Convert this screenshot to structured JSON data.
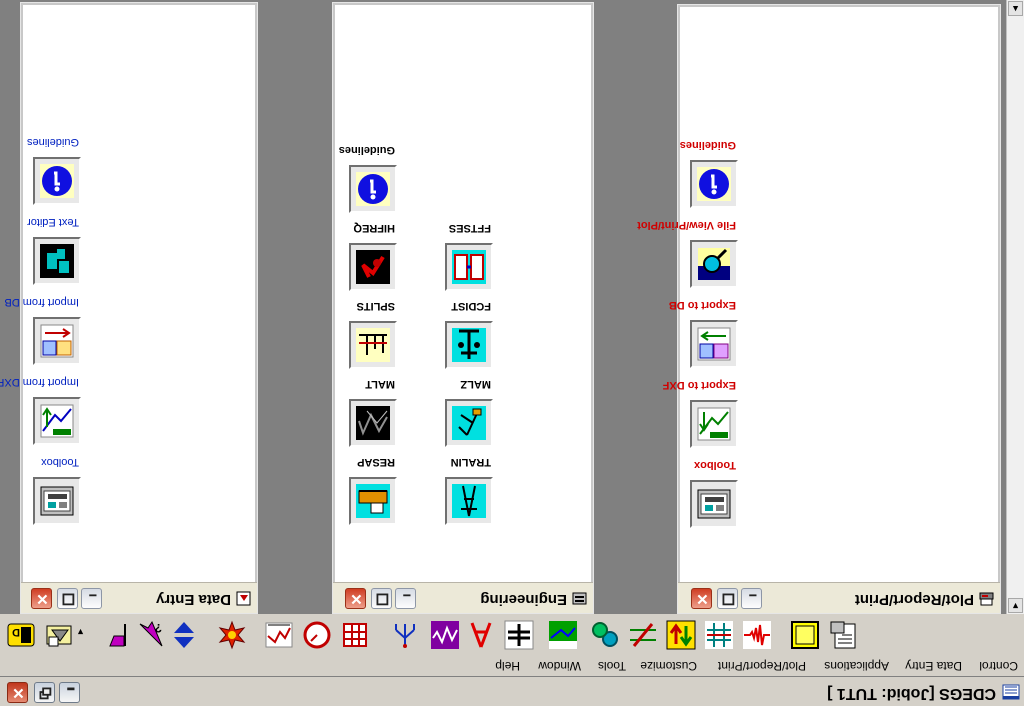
{
  "app": {
    "title": "CDEGS [Jobid: TUT1 ]"
  },
  "menu": {
    "items": [
      "Control",
      "Data Entry",
      "Applications",
      "Plot/Report/Print",
      "Customize",
      "Tools",
      "Window",
      "Help"
    ]
  },
  "toolbar": {
    "icons": [
      "id-icon",
      "data-entry-icon",
      "applications-icon",
      "plot-icon",
      "customize-icon",
      "tools-icon",
      "window-icon",
      "help-icon"
    ]
  },
  "windows": {
    "data_entry": {
      "title": "Data Entry",
      "items": [
        "Toolbox",
        "Import from DXF",
        "Import from DB",
        "Text Editor",
        "Guidelines"
      ]
    },
    "engineering": {
      "title": "Engineering",
      "items": [
        "RESAP",
        "TRALIN",
        "MALT",
        "MALZ",
        "SPLITS",
        "FCDIST",
        "HIFREQ",
        "FFTSES",
        "Guidelines"
      ]
    },
    "plot": {
      "title": "Plot/Report/Print",
      "items": [
        "Toolbox",
        "Export to DXF",
        "Export to DB",
        "File View/Print/Plot",
        "Guidelines"
      ]
    }
  },
  "colors": {
    "desktop": "#808080",
    "chrome": "#d4d0c8",
    "label_blue": "#0020c0",
    "label_red": "#d00000"
  }
}
